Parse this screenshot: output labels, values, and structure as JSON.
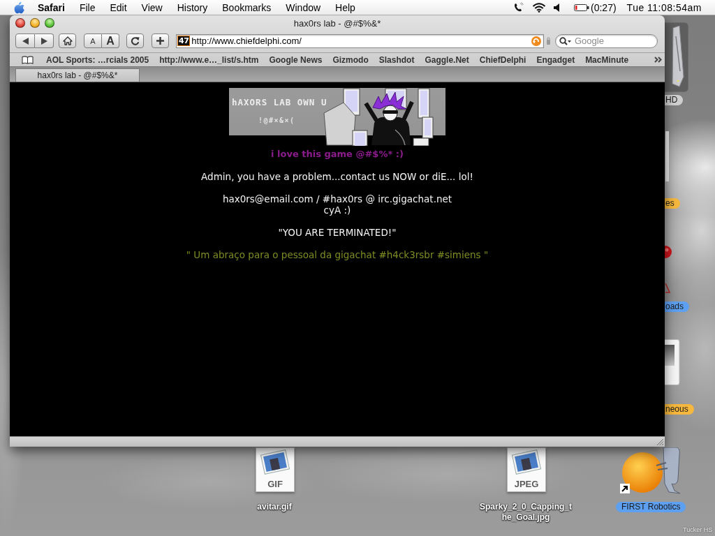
{
  "menu_bar": {
    "app_name": "Safari",
    "menus": [
      "File",
      "Edit",
      "View",
      "History",
      "Bookmarks",
      "Window",
      "Help"
    ],
    "battery_time": "(0:27)",
    "clock": "Tue 11:08:54am"
  },
  "window": {
    "title": "hax0rs lab - @#$%&*",
    "toolbar": {
      "text_smaller": "A",
      "text_larger": "A",
      "favicon": "47",
      "address": "http://www.chiefdelphi.com/",
      "search": {
        "placeholder": "Google"
      }
    },
    "bookmarks": [
      "AOL Sports: …rcials 2005",
      "http://www.e…_list/s.htm",
      "Google News",
      "Gizmodo",
      "Slashdot",
      "Gaggle.Net",
      "ChiefDelphi",
      "Engadget",
      "MacMinute"
    ],
    "tabs": [
      {
        "label": "hax0rs lab - @#$%&*",
        "selected": true
      }
    ],
    "page": {
      "banner": {
        "title": "hAXORS LAB OWN U",
        "subtitle": "!@#×&×("
      },
      "paragraphs": [
        {
          "kind": "title",
          "lines": [
            "i love this game @#$%* :)"
          ]
        },
        {
          "kind": "plain",
          "lines": [
            "Admin, you have a problem...contact us NOW or diE... lol!"
          ]
        },
        {
          "kind": "plain",
          "lines": [
            "hax0rs@email.com / #hax0rs @ irc.gigachat.net",
            "cyA :)"
          ]
        },
        {
          "kind": "plain",
          "lines": [
            "\"YOU ARE TERMINATED!\""
          ]
        },
        {
          "kind": "footer",
          "lines": [
            "\" Um abraço para o pessoal da gigachat #h4ck3rsbr #simiens \""
          ]
        }
      ]
    }
  },
  "desktop_icons": [
    {
      "kind": "disk",
      "label": "HD",
      "color": "#cfcfcf"
    },
    {
      "kind": "folder",
      "label": "es",
      "color": "#f5b73d"
    },
    {
      "kind": "ball",
      "label": "oads",
      "color": "#5d9ff0"
    },
    {
      "kind": "device",
      "label": "neous",
      "color": "#f5b73d"
    },
    {
      "kind": "image-file",
      "badge": "GIF",
      "label": "avitar.gif"
    },
    {
      "kind": "image-file",
      "badge": "JPEG",
      "label": "Sparky_2_0_Capping_the_Goal.jpg"
    },
    {
      "kind": "alias-app",
      "label": "FIRST Robotics",
      "color": "#5d9ff0"
    }
  ],
  "corner_text": "Tucker HS"
}
